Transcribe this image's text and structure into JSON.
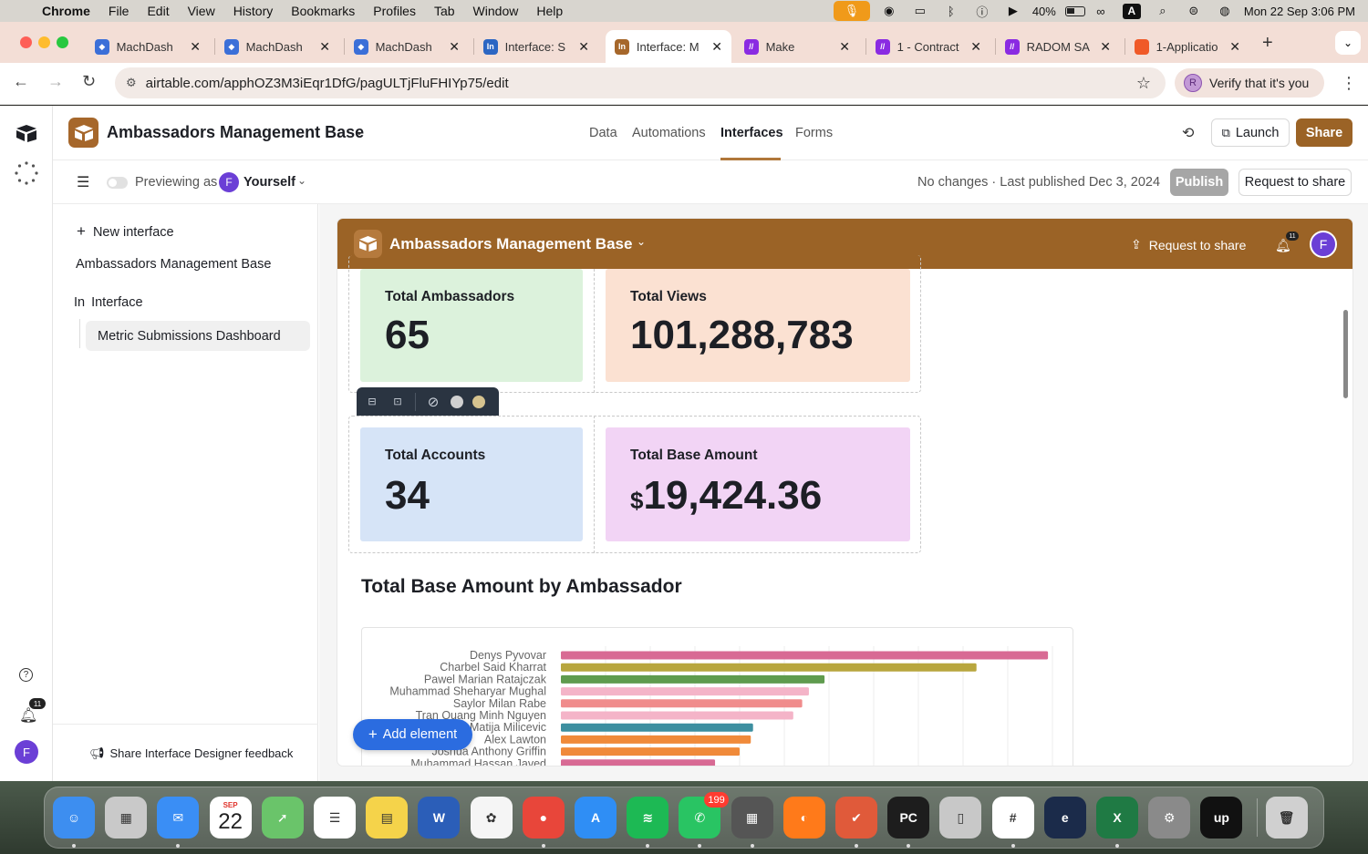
{
  "menubar": {
    "app": "Chrome",
    "items": [
      "File",
      "Edit",
      "View",
      "History",
      "Bookmarks",
      "Profiles",
      "Tab",
      "Window",
      "Help"
    ],
    "battery": "40%",
    "input_source": "A",
    "datetime": "Mon 22 Sep  3:06 PM"
  },
  "tabs": [
    {
      "label": "MachDash",
      "favicon_color": "#3b6fd8",
      "favicon_glyph": "◆"
    },
    {
      "label": "MachDash",
      "favicon_color": "#3b6fd8",
      "favicon_glyph": "◆"
    },
    {
      "label": "MachDash",
      "favicon_color": "#3b6fd8",
      "favicon_glyph": "◆"
    },
    {
      "label": "Interface: S",
      "favicon_color": "#2c66c3",
      "favicon_glyph": "In"
    },
    {
      "label": "Interface: M",
      "favicon_color": "#a6672b",
      "favicon_glyph": "In"
    },
    {
      "label": "Make",
      "favicon_color": "#8a2be2",
      "favicon_glyph": "//"
    },
    {
      "label": "1 - Contract",
      "favicon_color": "#8a2be2",
      "favicon_glyph": "//"
    },
    {
      "label": "RADOM SA",
      "favicon_color": "#8a2be2",
      "favicon_glyph": "//"
    },
    {
      "label": "1-Applicatio",
      "favicon_color": "#f05a28",
      "favicon_glyph": ""
    }
  ],
  "address": {
    "url": "airtable.com/apphOZ3M3iEqr1DfG/pagULTjFluFHIYp75/edit",
    "verify_label": "Verify that it's you",
    "verify_initial": "R"
  },
  "app": {
    "base_title": "Ambassadors Management Base",
    "nav": [
      "Data",
      "Automations",
      "Interfaces",
      "Forms"
    ],
    "nav_active": "Interfaces",
    "launch_label": "Launch",
    "share_label": "Share",
    "previewing_as": "Previewing as",
    "preview_user": "Yourself",
    "user_initial": "F",
    "status": "No changes · Last published Dec 3, 2024",
    "publish_label": "Publish",
    "request_share_label": "Request to share",
    "notification_count": "11",
    "brand_color": "#9b6326"
  },
  "sidebar": {
    "new_interface": "New interface",
    "base_name": "Ambassadors Management Base",
    "group_name": "Interface",
    "group_prefix": "In",
    "page_name": "Metric Submissions Dashboard",
    "feedback": "Share Interface Designer feedback"
  },
  "interface": {
    "title": "Ambassadors Management Base",
    "request_share": "Request to share",
    "notification_count": "11",
    "user_initial": "F",
    "metrics": [
      {
        "label": "Total Ambassadors",
        "value": "65",
        "bg": "#dcf2dc"
      },
      {
        "label": "Total Views",
        "value": "101,288,783",
        "bg": "#fbe1d2"
      },
      {
        "label": "Total Accounts",
        "value": "34",
        "bg": "#d6e4f7"
      },
      {
        "label": "Total Base Amount",
        "currency": "$",
        "value": "19,424.36",
        "bg": "#f2d4f5"
      }
    ],
    "toolbar_dot_colors": [
      "#d0d0d0",
      "#d6c38f"
    ],
    "add_element": "Add element"
  },
  "chart_data": {
    "type": "bar",
    "orientation": "horizontal",
    "title": "Total Base Amount by Ambassador",
    "xlabel": "",
    "ylabel": "",
    "grid": true,
    "categories": [
      "Denys Pyvovar",
      "Charbel Said Kharrat",
      "Pawel Marian Ratajczak",
      "Muhammad Sheharyar Mughal",
      "Saylor Milan Rabe",
      "Tran Quang Minh Nguyen",
      "Matija Milicevic",
      "Alex Lawton",
      "Joshua Anthony Griffin",
      "Muhammad Hassan Javed"
    ],
    "values": [
      1090,
      930,
      590,
      555,
      540,
      520,
      430,
      425,
      400,
      345
    ],
    "colors": [
      "#d86a94",
      "#b8a63e",
      "#5f9b4e",
      "#f4b4c8",
      "#f08c8c",
      "#f4b4c8",
      "#3d8fa0",
      "#f08a3a",
      "#f08a3a",
      "#d86a94"
    ],
    "xlim": [
      0,
      1100
    ]
  },
  "dock": {
    "calendar_month": "SEP",
    "calendar_day": "22",
    "whatsapp_badge": "199",
    "apps": [
      {
        "name": "finder-icon",
        "color": "#3d8ef0",
        "glyph": "☺"
      },
      {
        "name": "launchpad-icon",
        "color": "#c9c9c9",
        "glyph": "▦"
      },
      {
        "name": "mail-icon",
        "color": "#3a8ef5",
        "glyph": "✉"
      },
      {
        "name": "calendar-icon",
        "color": "#ffffff",
        "glyph": ""
      },
      {
        "name": "maps-icon",
        "color": "#6ac46a",
        "glyph": "➚"
      },
      {
        "name": "reminders-icon",
        "color": "#ffffff",
        "glyph": "☰"
      },
      {
        "name": "notes-icon",
        "color": "#f5d34a",
        "glyph": "▤"
      },
      {
        "name": "word-icon",
        "color": "#2b5eb8",
        "glyph": "W"
      },
      {
        "name": "photos-icon",
        "color": "#f5f5f5",
        "glyph": "✿"
      },
      {
        "name": "chrome-icon",
        "color": "#e8463a",
        "glyph": "●"
      },
      {
        "name": "app-store-icon",
        "color": "#2f8ef5",
        "glyph": "A"
      },
      {
        "name": "spotify-icon",
        "color": "#1db954",
        "glyph": "≋"
      },
      {
        "name": "whatsapp-icon",
        "color": "#29c463",
        "glyph": "✆"
      },
      {
        "name": "calculator-icon",
        "color": "#555555",
        "glyph": "▦"
      },
      {
        "name": "firefox-icon",
        "color": "#ff7a1a",
        "glyph": "◐"
      },
      {
        "name": "ticktick-icon",
        "color": "#e05a3a",
        "glyph": "✔"
      },
      {
        "name": "pycharm-icon",
        "color": "#1d1d1d",
        "glyph": "PC"
      },
      {
        "name": "iphone-mirroring-icon",
        "color": "#c8c8c8",
        "glyph": "▯"
      },
      {
        "name": "slack-icon",
        "color": "#ffffff",
        "glyph": "#"
      },
      {
        "name": "edge-icon",
        "color": "#1b2b4a",
        "glyph": "e"
      },
      {
        "name": "excel-icon",
        "color": "#1f7a44",
        "glyph": "X"
      },
      {
        "name": "system-settings-icon",
        "color": "#8a8a8a",
        "glyph": "⚙"
      },
      {
        "name": "upwork-icon",
        "color": "#111111",
        "glyph": "up"
      },
      {
        "name": "trash-icon",
        "color": "#d0d0d0",
        "glyph": "🗑"
      }
    ]
  }
}
